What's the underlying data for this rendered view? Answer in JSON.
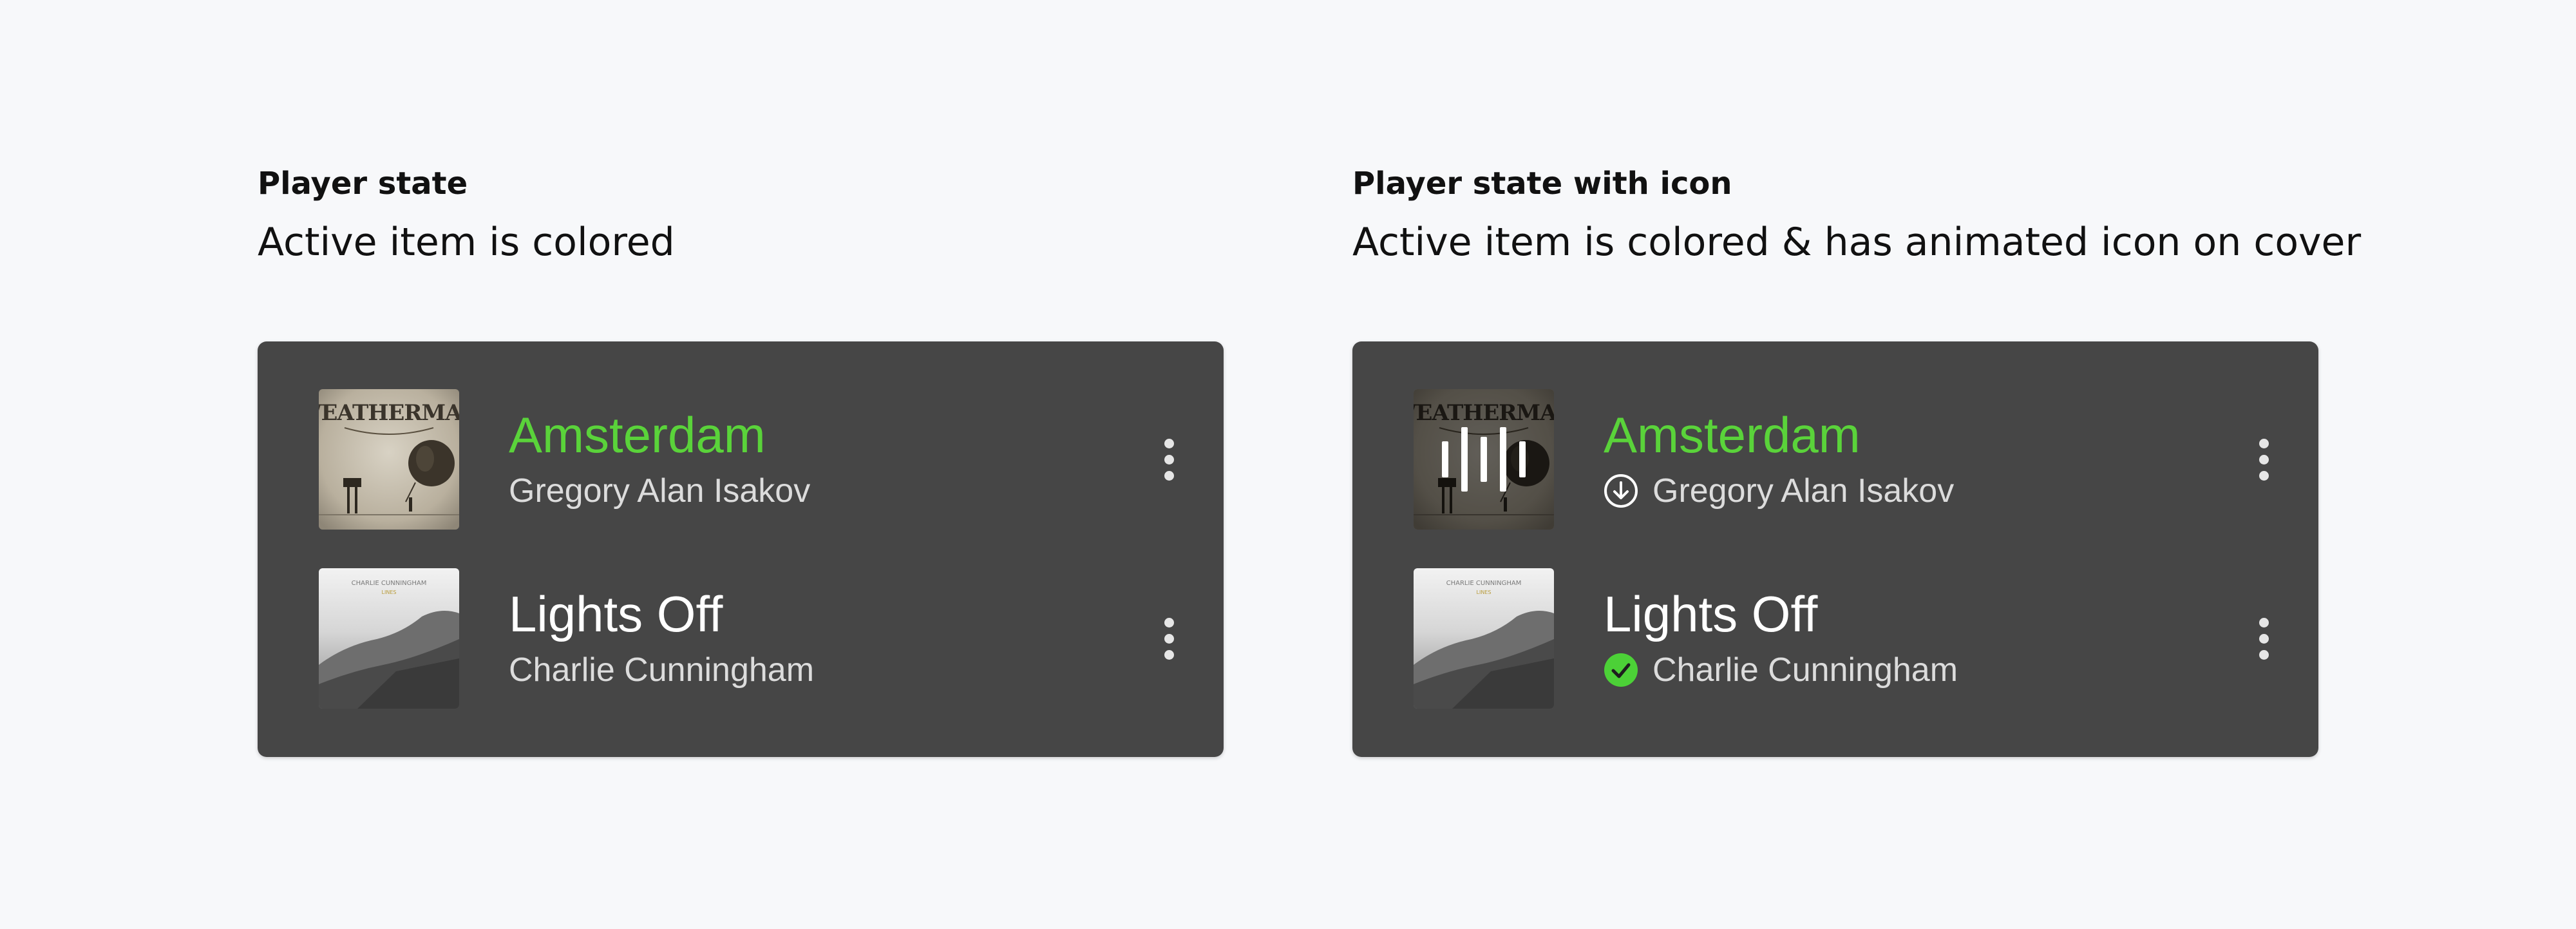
{
  "colors": {
    "background": "#f7f8fa",
    "panel": "#464646",
    "active_title": "#5ad33a",
    "title": "#ffffff",
    "artist": "#dcdcdc",
    "downloaded_badge": "#4cd137"
  },
  "sections": [
    {
      "heading": "Player state",
      "description": "Active item is colored",
      "tracks": [
        {
          "title": "Amsterdam",
          "artist": "Gregory Alan Isakov",
          "active": true,
          "cover_icon": "weatherman-album-cover",
          "status_icon": null,
          "menu_icon": "more-vertical-icon"
        },
        {
          "title": "Lights Off",
          "artist": "Charlie Cunningham",
          "active": false,
          "cover_icon": "charlie-cunningham-album-cover",
          "status_icon": null,
          "menu_icon": "more-vertical-icon"
        }
      ]
    },
    {
      "heading": "Player state with icon",
      "description": "Active item is colored & has animated icon on cover",
      "tracks": [
        {
          "title": "Amsterdam",
          "artist": "Gregory Alan Isakov",
          "active": true,
          "cover_icon": "weatherman-album-cover",
          "cover_overlay_icon": "equalizer-bars-icon",
          "status_icon": "download-circle-icon",
          "menu_icon": "more-vertical-icon"
        },
        {
          "title": "Lights Off",
          "artist": "Charlie Cunningham",
          "active": false,
          "cover_icon": "charlie-cunningham-album-cover",
          "status_icon": "downloaded-check-icon",
          "menu_icon": "more-vertical-icon"
        }
      ]
    }
  ]
}
